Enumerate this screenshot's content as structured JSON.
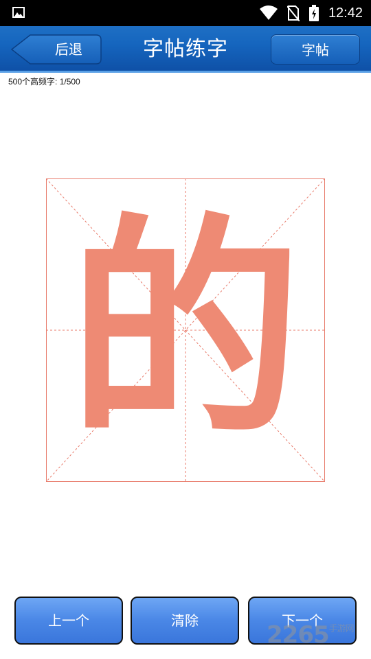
{
  "status_bar": {
    "time": "12:42"
  },
  "header": {
    "back_label": "后退",
    "title": "字帖练字",
    "copybook_label": "字帖"
  },
  "progress": {
    "label": "500个高频字: 1/500",
    "current": 1,
    "total": 500
  },
  "practice": {
    "character": "的",
    "glyph_color": "#ee8a74",
    "grid_color": "#e87b6b"
  },
  "footer": {
    "prev_label": "上一个",
    "clear_label": "清除",
    "next_label": "下一个"
  },
  "watermark": {
    "text": "2265",
    "suffix": "手游网"
  }
}
